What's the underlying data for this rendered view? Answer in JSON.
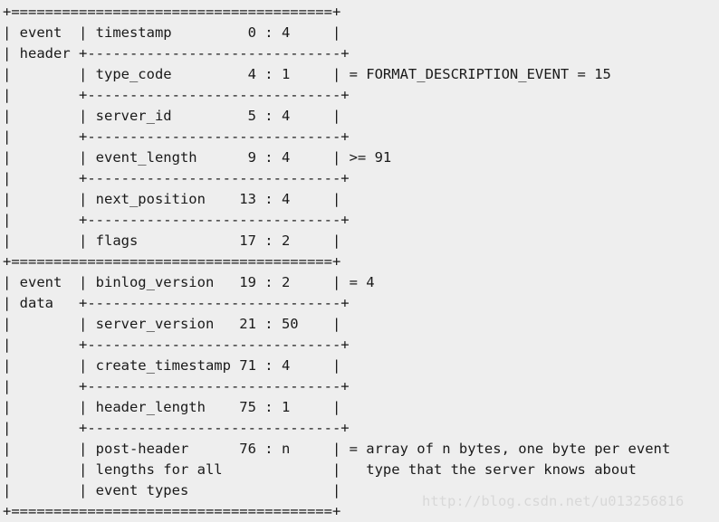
{
  "document": {
    "kind": "ascii-art-diagram",
    "subject": "MySQL binlog FORMAT_DESCRIPTION_EVENT layout",
    "background_color": "#eeeeee",
    "text_color": "#1a1a1a",
    "watermark_color": "#d8d8d8"
  },
  "layout": {
    "box_width_chars": 40,
    "label_column_chars": 10,
    "heavy_rule_char": "=",
    "light_rule_char": "-",
    "corner_char": "+",
    "vertical_char": "|"
  },
  "sections": [
    {
      "name": "event header",
      "label_lines": [
        "event",
        "header"
      ],
      "fields": [
        {
          "name": "timestamp",
          "offset": "0",
          "length": "4",
          "note": ""
        },
        {
          "name": "type_code",
          "offset": "4",
          "length": "1",
          "note": "= FORMAT_DESCRIPTION_EVENT = 15"
        },
        {
          "name": "server_id",
          "offset": "5",
          "length": "4",
          "note": ""
        },
        {
          "name": "event_length",
          "offset": "9",
          "length": "4",
          "note": ">= 91"
        },
        {
          "name": "next_position",
          "offset": "13",
          "length": "4",
          "note": ""
        },
        {
          "name": "flags",
          "offset": "17",
          "length": "2",
          "note": ""
        }
      ]
    },
    {
      "name": "event data",
      "label_lines": [
        "event",
        "data"
      ],
      "fields": [
        {
          "name": "binlog_version",
          "offset": "19",
          "length": "2",
          "note": "= 4"
        },
        {
          "name": "server_version",
          "offset": "21",
          "length": "50",
          "note": ""
        },
        {
          "name": "create_timestamp",
          "offset": "71",
          "length": "4",
          "note": ""
        },
        {
          "name": "header_length",
          "offset": "75",
          "length": "1",
          "note": ""
        },
        {
          "name": "post-header",
          "name_extra_lines": [
            "lengths for all",
            "event types"
          ],
          "offset": "76",
          "length": "n",
          "note": "= array of n bytes, one byte per event",
          "note_extra_lines": [
            "  type that the server knows about"
          ]
        }
      ]
    }
  ],
  "ascii": "+======================================+\n| event  | timestamp         0 : 4     |\n| header +------------------------------+\n|        | type_code         4 : 1     | = FORMAT_DESCRIPTION_EVENT = 15\n|        +------------------------------+\n|        | server_id         5 : 4     |\n|        +------------------------------+\n|        | event_length      9 : 4     | >= 91\n|        +------------------------------+\n|        | next_position    13 : 4     |\n|        +------------------------------+\n|        | flags            17 : 2     |\n+======================================+\n| event  | binlog_version   19 : 2     | = 4\n| data   +------------------------------+\n|        | server_version   21 : 50    |\n|        +------------------------------+\n|        | create_timestamp 71 : 4     |\n|        +------------------------------+\n|        | header_length    75 : 1     |\n|        +------------------------------+\n|        | post-header      76 : n     | = array of n bytes, one byte per event\n|        | lengths for all             |   type that the server knows about\n|        | event types                 |\n+======================================+",
  "watermark": {
    "text": "http://blog.csdn.net/u013256816"
  }
}
